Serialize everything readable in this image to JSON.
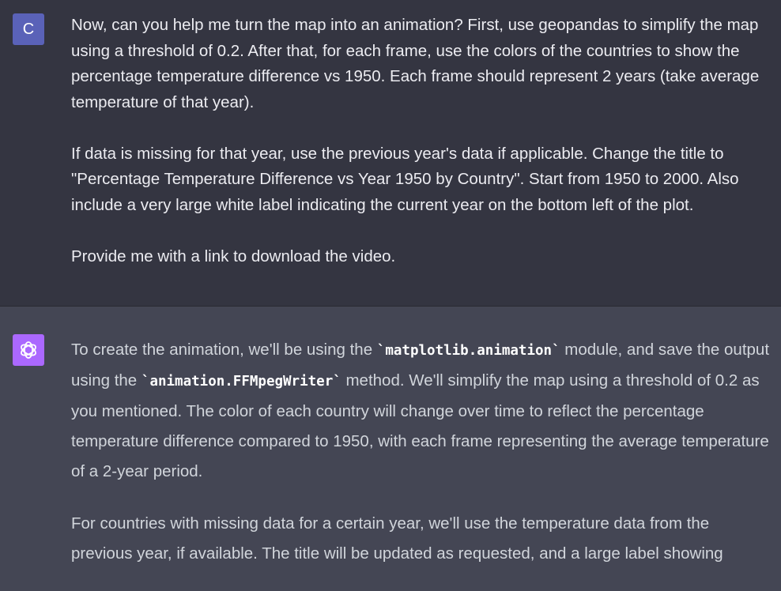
{
  "user_message": {
    "avatar_initial": "C",
    "paragraphs": [
      "Now, can you help me turn the map into an animation? First, use geopandas to simplify the map using a threshold of 0.2. After that, for each frame, use the colors of the countries to show the percentage temperature difference vs 1950. Each frame should represent 2 years (take average temperature of that year).",
      "If data is missing for that year, use the previous year's data if applicable. Change the title to \"Percentage Temperature Difference vs Year 1950 by Country\". Start from 1950 to 2000. Also include a very large white label indicating the current year on the bottom left of the plot.",
      "Provide me with a link to download the video."
    ]
  },
  "assistant_message": {
    "avatar_icon": "openai-logo-icon",
    "p1": {
      "t1": "To create the animation, we'll be using the ",
      "c1": "`matplotlib.animation`",
      "t2": " module, and save the output using the ",
      "c2": "`animation.FFMpegWriter`",
      "t3": " method. We'll simplify the map using a threshold of 0.2 as you mentioned. The color of each country will change over time to reflect the percentage temperature difference compared to 1950, with each frame representing the average temperature of a 2-year period."
    },
    "p2": "For countries with missing data for a certain year, we'll use the temperature data from the previous year, if available. The title will be updated as requested, and a large label showing"
  },
  "colors": {
    "user_bg": "#343541",
    "assistant_bg": "#444654",
    "user_avatar": "#5a62b8",
    "gpt_avatar": "#ab68ff"
  }
}
